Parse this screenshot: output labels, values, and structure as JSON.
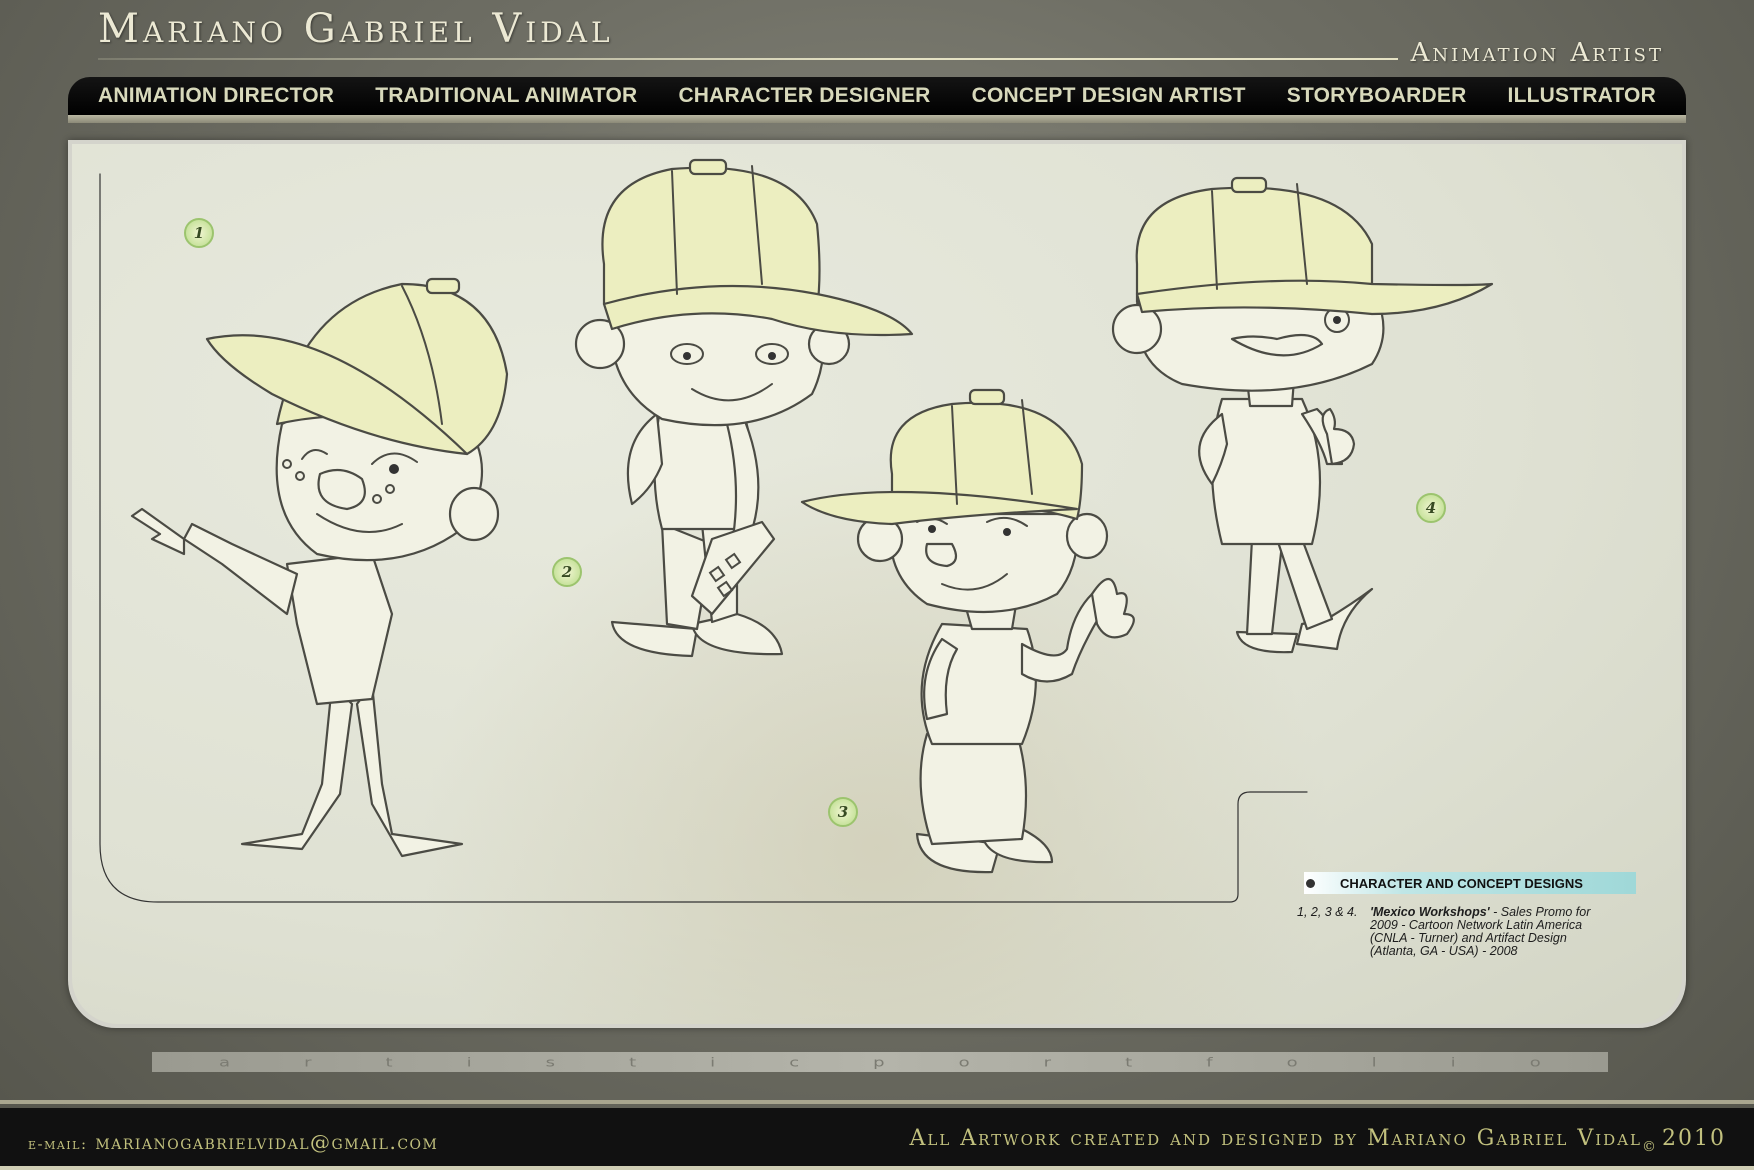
{
  "header": {
    "title": "Mariano Gabriel Vidal",
    "subtitle": "Animation Artist"
  },
  "nav": {
    "items": [
      {
        "label": "ANIMATION DIRECTOR"
      },
      {
        "label": "TRADITIONAL ANIMATOR"
      },
      {
        "label": "CHARACTER DESIGNER"
      },
      {
        "label": "CONCEPT DESIGN ARTIST"
      },
      {
        "label": "STORYBOARDER"
      },
      {
        "label": "ILLUSTRATOR"
      }
    ]
  },
  "artwork": {
    "badges": [
      "1",
      "2",
      "3",
      "4"
    ],
    "caption_title": "CHARACTER AND CONCEPT DESIGNS",
    "caption_lead": "1, 2, 3 & 4.",
    "caption_workshop": "'Mexico Workshops'",
    "caption_line1": "- Sales Promo for",
    "caption_line2": "2009 - Cartoon Network Latin America",
    "caption_line3": "(CNLA - Turner) and Artifact Design",
    "caption_line4": "(Atlanta, GA - USA) - 2008"
  },
  "banner": {
    "letters": [
      "a",
      "r",
      "t",
      "i",
      "s",
      "t",
      "i",
      "c",
      "p",
      "o",
      "r",
      "t",
      "f",
      "o",
      "l",
      "i",
      "o"
    ]
  },
  "footer": {
    "email_label": "e-mail:",
    "email": "marianogabrielvidal@gmail.com",
    "credits": "All Artwork created and designed by Mariano Gabriel Vidal",
    "copyright_symbol": "©",
    "year": "2010"
  },
  "colors": {
    "nav_background": "#000000",
    "nav_text": "#d8d9bb",
    "footer_text": "#c2c17e",
    "badge_green": "#c9e39e",
    "caption_cyan": "#9fd8d8"
  }
}
